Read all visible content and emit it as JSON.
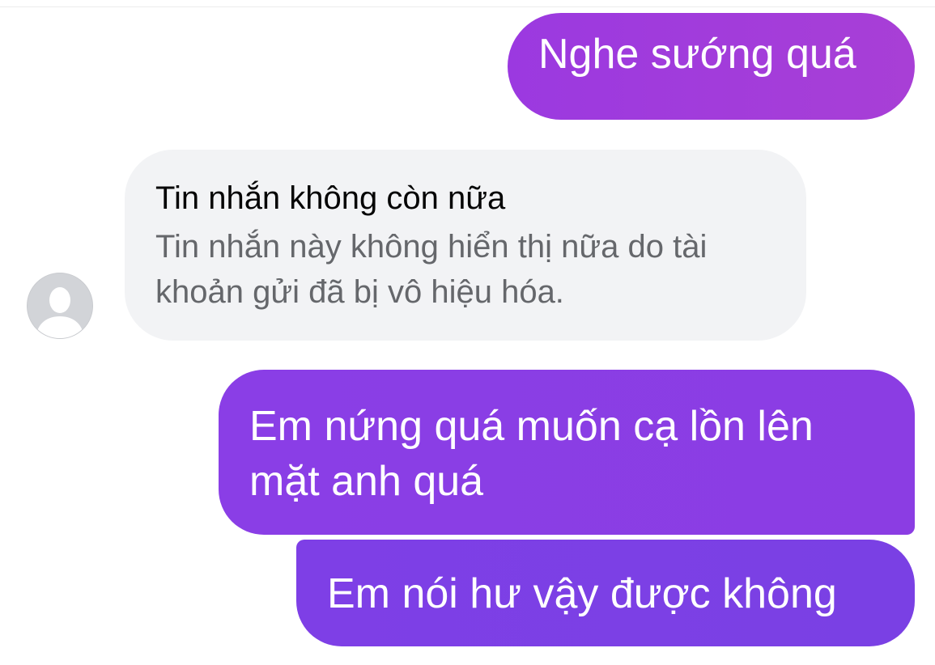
{
  "messages": [
    {
      "id": "m1",
      "direction": "outgoing",
      "text": "Nghe sướng quá"
    },
    {
      "id": "m2",
      "direction": "incoming",
      "title": "Tin nhắn không còn nữa",
      "body": "Tin nhắn này không hiển thị nữa do tài khoản gửi đã bị vô hiệu hóa."
    },
    {
      "id": "m3",
      "direction": "outgoing",
      "text": "Em nứng quá muốn cạ lồn lên mặt anh quá"
    },
    {
      "id": "m4",
      "direction": "outgoing",
      "text": "Em nói hư vậy được không"
    }
  ],
  "avatar": {
    "icon": "default-user-avatar-icon"
  },
  "colors": {
    "outgoing_top": "#a83fd6",
    "outgoing_bottom": "#7a40e4",
    "incoming_bg": "#f2f3f5",
    "incoming_title": "#050505",
    "incoming_body": "#65676b"
  }
}
